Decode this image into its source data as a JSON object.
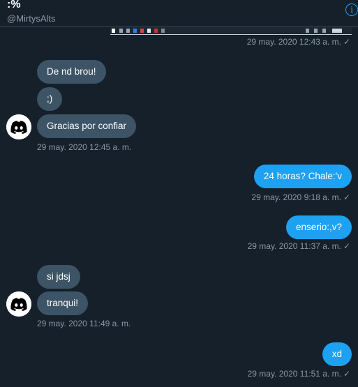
{
  "header": {
    "title": ":%",
    "handle": "@MirtysAlts",
    "info_icon": "info-icon"
  },
  "colors": {
    "background": "#15202b",
    "incoming_bubble": "#3d5466",
    "outgoing_bubble": "#1da1f2",
    "muted_text": "#8899a6"
  },
  "messages": [
    {
      "side": "out",
      "kind": "image",
      "time": "29 may. 2020 12:43 a. m.",
      "read": "✓"
    },
    {
      "side": "in",
      "text": "De nd brou!"
    },
    {
      "side": "in",
      "text": ";)"
    },
    {
      "side": "in",
      "text": "Gracias por confiar",
      "time": "29 may. 2020 12:45 a. m.",
      "avatar": "discord-logo-icon"
    },
    {
      "side": "out",
      "text": "24 horas? Chale:'v",
      "time": "29 may. 2020 9:18 a. m.",
      "read": "✓"
    },
    {
      "side": "out",
      "text": "enserio:,v?",
      "time": "29 may. 2020 11:37 a. m.",
      "read": "✓"
    },
    {
      "side": "in",
      "text": "si jdsj"
    },
    {
      "side": "in",
      "text": "tranqui!",
      "time": "29 may. 2020 11:49 a. m.",
      "avatar": "discord-logo-icon"
    },
    {
      "side": "out",
      "text": "xd",
      "time": "29 may. 2020 11:51 a. m.",
      "read": "✓"
    }
  ]
}
